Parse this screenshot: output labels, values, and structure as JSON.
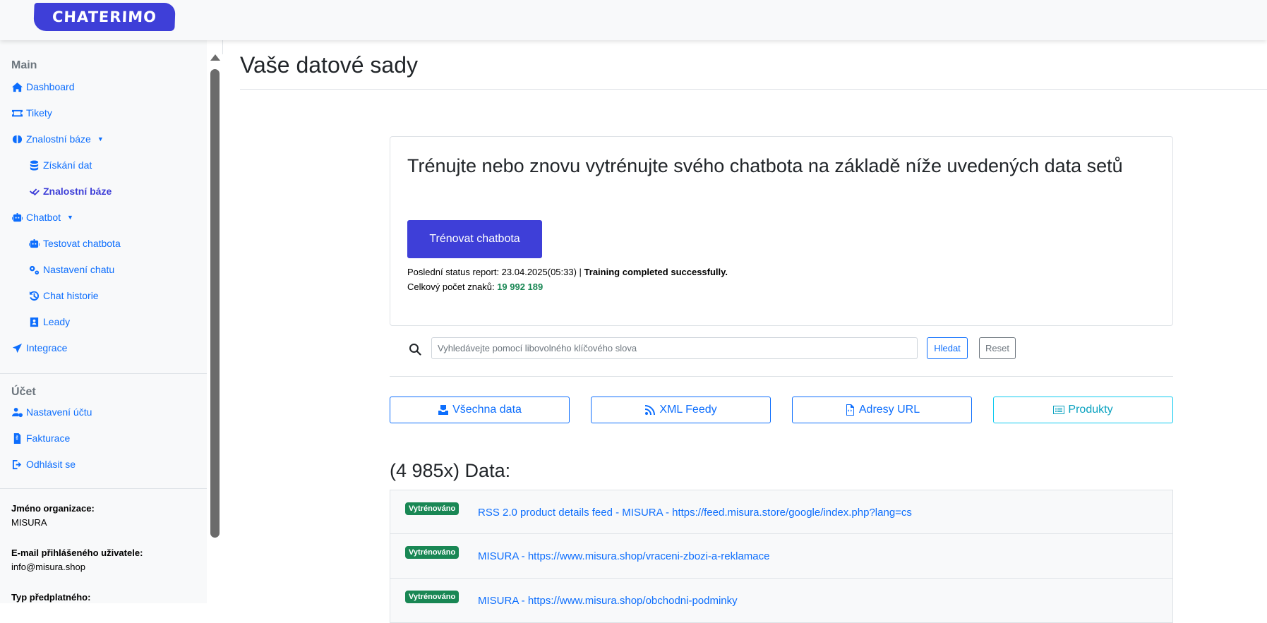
{
  "brand": {
    "logo_text": "CHATERIMO",
    "accent": "#3e3fd8"
  },
  "sidebar": {
    "main_title": "Main",
    "items": [
      {
        "label": "Dashboard",
        "icon": "home-icon"
      },
      {
        "label": "Tikety",
        "icon": "ticket-icon"
      },
      {
        "label": "Znalostní báze",
        "icon": "brain-icon",
        "dropdown": true
      },
      {
        "label": "Získání dat",
        "icon": "database-icon"
      },
      {
        "label": "Znalostní báze",
        "icon": "double-check-icon",
        "active": true
      },
      {
        "label": "Chatbot",
        "icon": "robot-icon",
        "dropdown": true
      },
      {
        "label": "Testovat chatbota",
        "icon": "robot-icon"
      },
      {
        "label": "Nastavení chatu",
        "icon": "gears-icon"
      },
      {
        "label": "Chat historie",
        "icon": "history-icon"
      },
      {
        "label": "Leady",
        "icon": "contact-card-icon"
      },
      {
        "label": "Integrace",
        "icon": "paper-plane-icon"
      }
    ],
    "account_title": "Účet",
    "account_items": [
      {
        "label": "Nastavení účtu",
        "icon": "user-gear-icon"
      },
      {
        "label": "Fakturace",
        "icon": "invoice-icon"
      },
      {
        "label": "Odhlásit se",
        "icon": "logout-icon"
      }
    ],
    "org_label": "Jméno organizace",
    "org_value": "MISURA",
    "email_label": "E-mail přihlášeného uživatele",
    "email_value": "info@misura.shop",
    "plan_label": "Typ předplatného"
  },
  "main": {
    "title": "Vaše datové sady",
    "card": {
      "heading": "Trénujte nebo znovu vytrénujte svého chatbota na základě níže uvedených data setů",
      "train_button": "Trénovat chatbota",
      "status_prefix": "Poslední status report: 23.04.2025(05:33) | ",
      "status_text": "Training completed successfully.",
      "chars_label": "Celkový počet znaků: ",
      "chars_value": "19 992 189"
    },
    "search": {
      "placeholder": "Vyhledávejte pomocí libovolného klíčového slova",
      "value": "",
      "search_button": "Hledat",
      "reset_button": "Reset"
    },
    "filters": [
      {
        "label": "Všechna data",
        "icon": "inbox-check-icon"
      },
      {
        "label": "XML Feedy",
        "icon": "rss-icon"
      },
      {
        "label": "Adresy URL",
        "icon": "file-code-icon"
      },
      {
        "label": "Produkty",
        "icon": "list-icon"
      }
    ],
    "data_heading": "(4 985x) Data:",
    "rows": [
      {
        "badge": "Vytrénováno",
        "link": "RSS 2.0 product details feed - MISURA - https://feed.misura.store/google/index.php?lang=cs"
      },
      {
        "badge": "Vytrénováno",
        "link": "MISURA - https://www.misura.shop/vraceni-zbozi-a-reklamace"
      },
      {
        "badge": "Vytrénováno",
        "link": "MISURA - https://www.misura.shop/obchodni-podminky"
      }
    ]
  }
}
